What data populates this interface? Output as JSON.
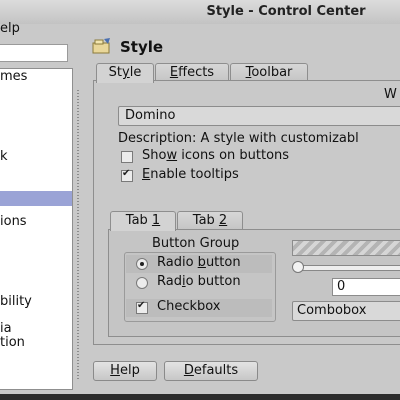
{
  "window": {
    "title": "Style - Control Center"
  },
  "menu": {
    "help": "elp"
  },
  "sidebar": {
    "search_value": "",
    "items": [
      {
        "label": "mes"
      },
      {
        "label": "k"
      },
      {
        "label": ""
      },
      {
        "label": "ions"
      },
      {
        "label": "bility"
      },
      {
        "label": "ia"
      },
      {
        "label": "tion"
      }
    ],
    "selected_index": 2
  },
  "header": {
    "title": "Style"
  },
  "tabs": [
    {
      "label_pre": "St",
      "label_ul": "y",
      "label_post": "le"
    },
    {
      "label_pre": "",
      "label_ul": "E",
      "label_post": "ffects"
    },
    {
      "label_pre": "",
      "label_ul": "T",
      "label_post": "oolbar"
    }
  ],
  "style_tab": {
    "group_label": "W",
    "style_combo_value": "Domino",
    "description": "Description: A style with customizabl",
    "show_icons": {
      "pre": "Sho",
      "ul": "w",
      "post": " icons on buttons",
      "checked": false
    },
    "enable_tooltips": {
      "pre": "",
      "ul": "E",
      "post": "nable tooltips",
      "checked": true
    }
  },
  "preview": {
    "tabs": [
      {
        "label_pre": "Tab ",
        "label_ul": "1",
        "label_post": ""
      },
      {
        "label_pre": "Tab ",
        "label_ul": "2",
        "label_post": ""
      }
    ],
    "button_group_label": "Button Group",
    "radio1": {
      "pre": "Radio ",
      "ul": "b",
      "post": "utton",
      "checked": true
    },
    "radio2": {
      "pre": "Rad",
      "ul": "i",
      "post": "o button",
      "checked": false
    },
    "checkbox": {
      "label": "Checkbox",
      "checked": true
    },
    "spin_value": "0",
    "combo_value": "Combobox",
    "slider_value": 0
  },
  "buttons": {
    "help": {
      "pre": "",
      "ul": "H",
      "post": "elp"
    },
    "defaults": {
      "pre": "",
      "ul": "D",
      "post": "efaults"
    }
  },
  "colors": {
    "selection": "#9aa3d6",
    "window_bg": "#c9c9c9"
  }
}
